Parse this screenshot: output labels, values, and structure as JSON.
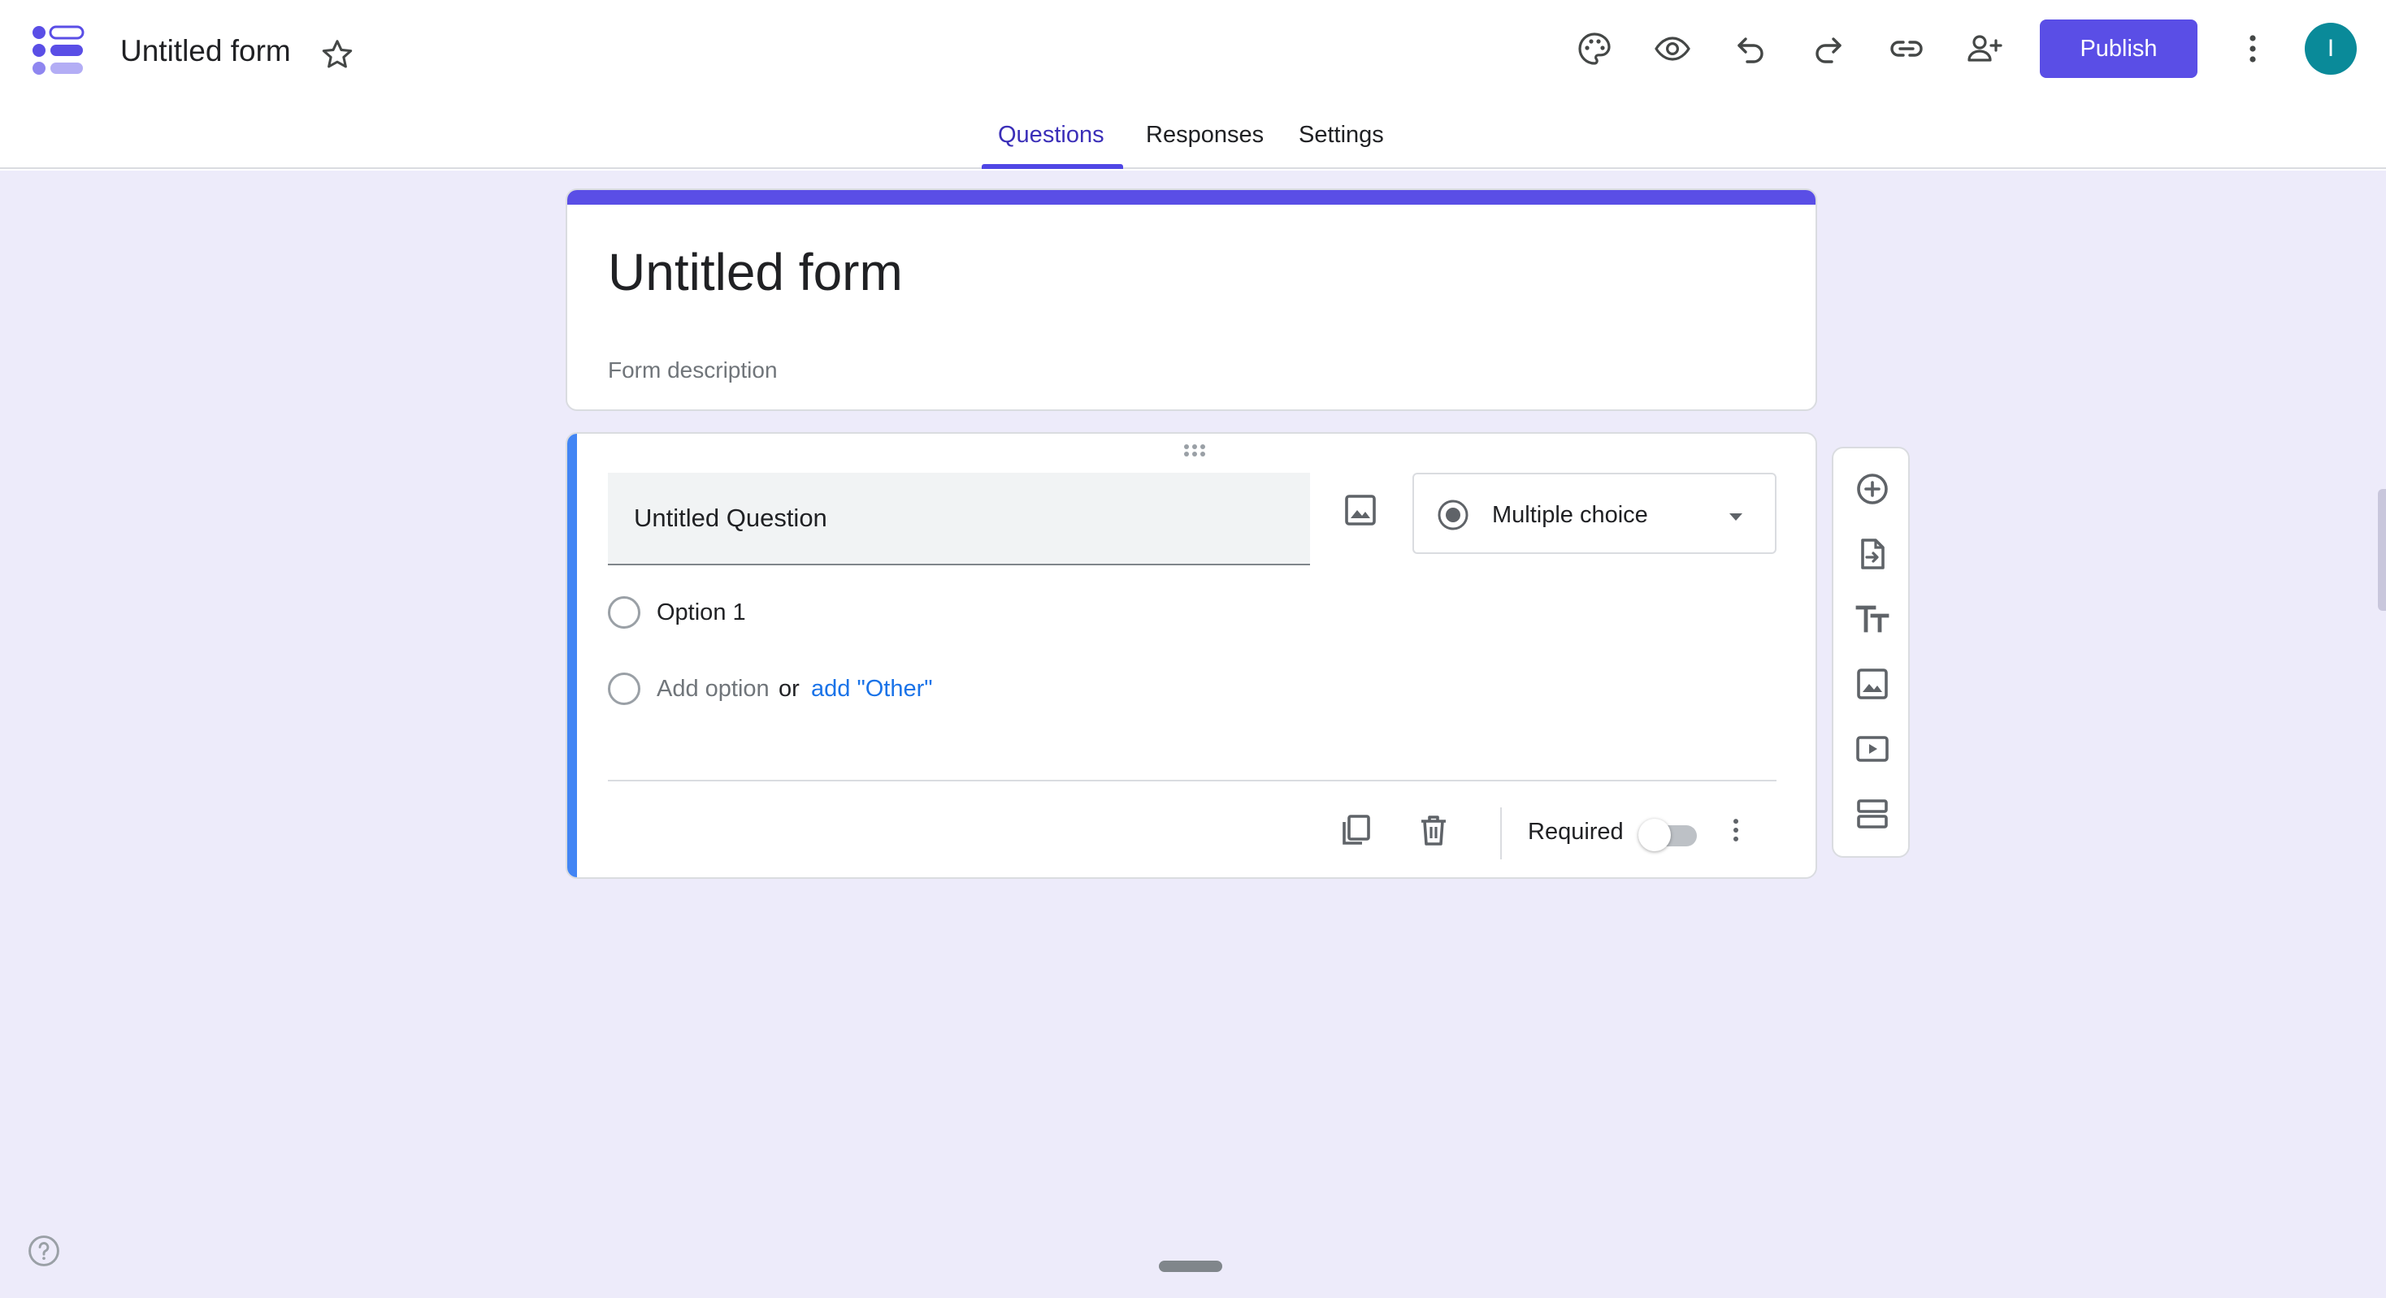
{
  "app": {
    "doc_title": "Untitled form",
    "brand_color": "#5a4ee6",
    "avatar_initial": "I",
    "avatar_color": "#0a8a99"
  },
  "toolbar": {
    "icons": [
      "palette-icon",
      "eye-icon",
      "undo-icon",
      "redo-icon",
      "link-icon",
      "add-collaborator-icon",
      "more-vert-icon"
    ],
    "publish_label": "Publish"
  },
  "tabs": [
    {
      "label": "Questions",
      "active": true
    },
    {
      "label": "Responses",
      "active": false
    },
    {
      "label": "Settings",
      "active": false
    }
  ],
  "form": {
    "title": "Untitled form",
    "description_placeholder": "Form description"
  },
  "question": {
    "title": "Untitled Question",
    "type_label": "Multiple choice",
    "options": [
      "Option 1"
    ],
    "add_option_label": "Add option",
    "or_label": "or",
    "add_other_label": "add \"Other\"",
    "required_label": "Required",
    "required": false
  },
  "side_toolbar": {
    "icons": [
      "add-question-icon",
      "import-questions-icon",
      "add-title-icon",
      "add-image-icon",
      "add-video-icon",
      "add-section-icon"
    ]
  },
  "footer": {
    "icons": [
      "help-icon"
    ]
  }
}
